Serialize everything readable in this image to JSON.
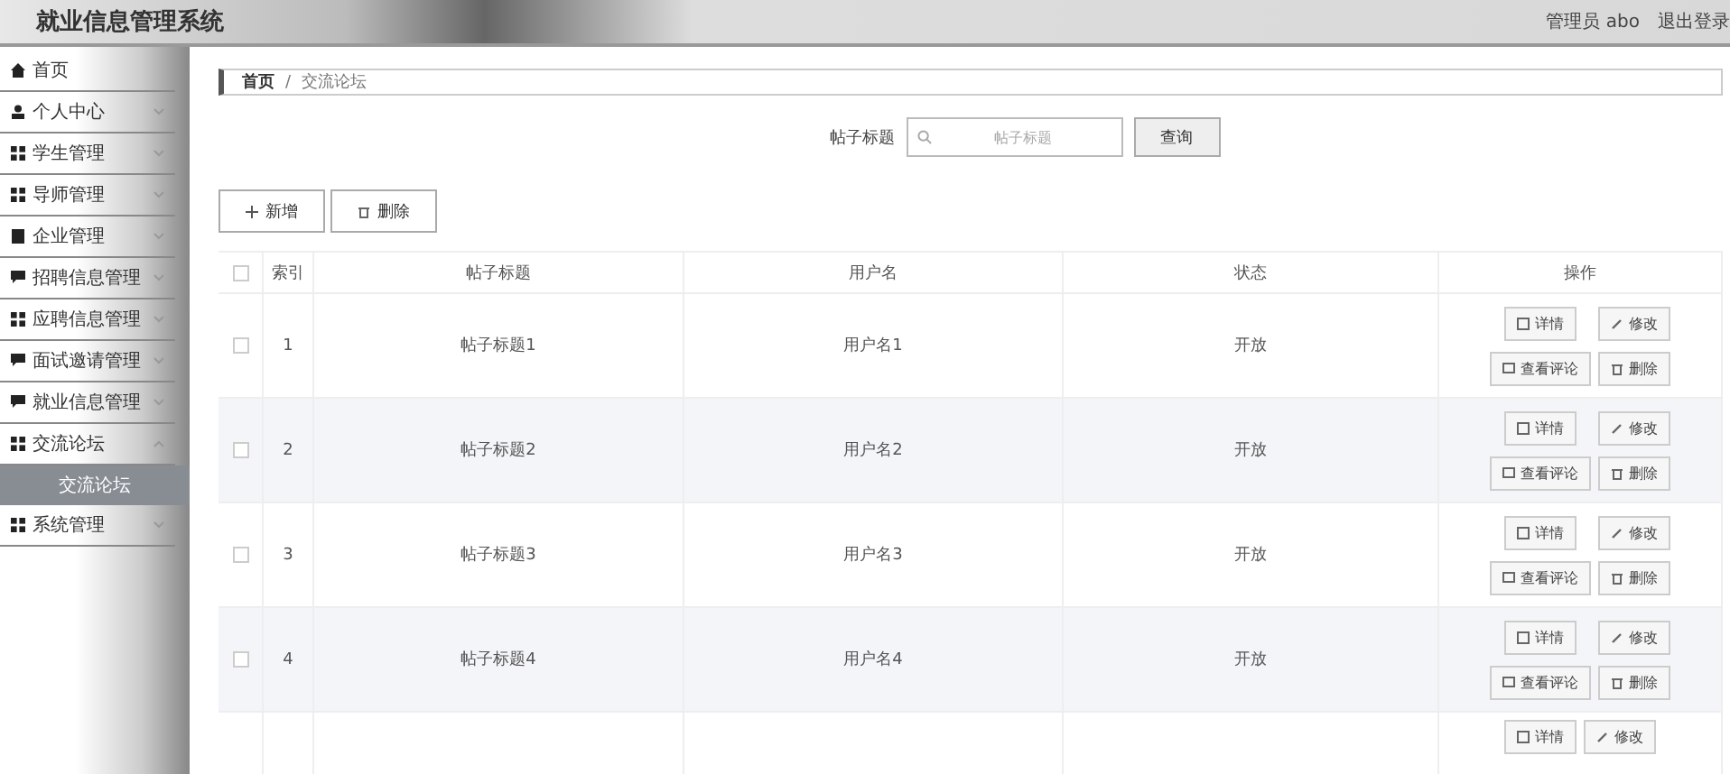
{
  "app_title": "就业信息管理系统",
  "header_user": "管理员 abo",
  "logout": "退出登录",
  "sidebar": [
    {
      "label": "首页",
      "kind": "home"
    },
    {
      "label": "个人中心",
      "kind": "user",
      "expanded": false
    },
    {
      "label": "学生管理",
      "kind": "grid",
      "expanded": false
    },
    {
      "label": "导师管理",
      "kind": "grid",
      "expanded": false
    },
    {
      "label": "企业管理",
      "kind": "doc",
      "expanded": false
    },
    {
      "label": "招聘信息管理",
      "kind": "chat",
      "expanded": false
    },
    {
      "label": "应聘信息管理",
      "kind": "grid",
      "expanded": false
    },
    {
      "label": "面试邀请管理",
      "kind": "chat",
      "expanded": false
    },
    {
      "label": "就业信息管理",
      "kind": "chat",
      "expanded": false
    },
    {
      "label": "交流论坛",
      "kind": "grid",
      "expanded": true,
      "children": [
        {
          "label": "交流论坛",
          "selected": true
        }
      ]
    },
    {
      "label": "系统管理",
      "kind": "grid",
      "expanded": false
    }
  ],
  "breadcrumb": [
    "首页",
    "交流论坛"
  ],
  "breadcrumb_separator": "/",
  "search": {
    "label": "帖子标题",
    "placeholder": "帖子标题",
    "button": "查询"
  },
  "actions": [
    {
      "label": "新增",
      "kind": "add"
    },
    {
      "label": "删除",
      "kind": "delete"
    }
  ],
  "table": {
    "select_all_checked": false,
    "columns": [
      "索引",
      "帖子标题",
      "用户名",
      "状态",
      "操作"
    ],
    "rows": [
      {
        "checked": false,
        "cells": [
          "1",
          "帖子标题1",
          "用户名1",
          "开放"
        ],
        "buttons": [
          {
            "label": "详情",
            "kind": "detail"
          },
          {
            "label": "修改",
            "kind": "edit"
          },
          {
            "label": "查看评论",
            "kind": "comments"
          },
          {
            "label": "删除",
            "kind": "delete"
          }
        ]
      },
      {
        "checked": false,
        "cells": [
          "2",
          "帖子标题2",
          "用户名2",
          "开放"
        ],
        "buttons": [
          {
            "label": "详情",
            "kind": "detail"
          },
          {
            "label": "修改",
            "kind": "edit"
          },
          {
            "label": "查看评论",
            "kind": "comments"
          },
          {
            "label": "删除",
            "kind": "delete"
          }
        ]
      },
      {
        "checked": false,
        "cells": [
          "3",
          "帖子标题3",
          "用户名3",
          "开放"
        ],
        "buttons": [
          {
            "label": "详情",
            "kind": "detail"
          },
          {
            "label": "修改",
            "kind": "edit"
          },
          {
            "label": "查看评论",
            "kind": "comments"
          },
          {
            "label": "删除",
            "kind": "delete"
          }
        ]
      },
      {
        "checked": false,
        "cells": [
          "4",
          "帖子标题4",
          "用户名4",
          "开放"
        ],
        "buttons": [
          {
            "label": "详情",
            "kind": "detail"
          },
          {
            "label": "修改",
            "kind": "edit"
          },
          {
            "label": "查看评论",
            "kind": "comments"
          },
          {
            "label": "删除",
            "kind": "delete"
          }
        ]
      }
    ],
    "partial_row_buttons": [
      {
        "label": "详情",
        "kind": "detail"
      },
      {
        "label": "修改",
        "kind": "edit"
      }
    ]
  }
}
